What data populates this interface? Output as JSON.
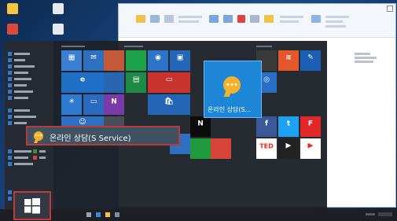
{
  "desktop": {
    "icons": [
      {
        "label": "",
        "color": "#f4c542"
      },
      {
        "label": "",
        "color": "#e6e9ef"
      },
      {
        "label": "",
        "color": "#d94a38"
      },
      {
        "label": "",
        "color": "#e6e9ef"
      }
    ]
  },
  "explorer": {
    "ribbon_tabs": [
      "",
      "",
      "",
      ""
    ]
  },
  "start_menu": {
    "search_row_label": "온라인 상담(S Service)",
    "popup_tile_label": "온라인 상담(S...",
    "tiles": [
      {
        "name": "tile-calendar",
        "label": "",
        "color": "#3b7fd0",
        "glyph": "▦"
      },
      {
        "name": "tile-mail",
        "label": "",
        "color": "#2f6fc0",
        "glyph": "✉"
      },
      {
        "name": "tile-news-photo",
        "label": "",
        "color": "#c25a3a",
        "glyph": ""
      },
      {
        "name": "tile-green-text",
        "label": "",
        "color": "#1fa34a",
        "glyph": ""
      },
      {
        "name": "tile-groove",
        "label": "",
        "color": "#2d73c8",
        "glyph": "◉"
      },
      {
        "name": "tile-movies",
        "label": "",
        "color": "#2566b8",
        "glyph": "▣"
      },
      {
        "name": "tile-edge",
        "label": "",
        "color": "#1f6fc7",
        "glyph": "e"
      },
      {
        "name": "tile-photos",
        "label": "",
        "color": "#2a65b0",
        "glyph": ""
      },
      {
        "name": "tile-excel-app",
        "label": "",
        "color": "#1f8a46",
        "glyph": "▤"
      },
      {
        "name": "tile-video-red",
        "label": "",
        "color": "#c9332d",
        "glyph": "▭"
      },
      {
        "name": "tile-weather",
        "label": "",
        "color": "#2e7ad1",
        "glyph": "☀"
      },
      {
        "name": "tile-pc",
        "label": "",
        "color": "#2a6bc0",
        "glyph": "▭"
      },
      {
        "name": "tile-onenote",
        "label": "",
        "color": "#7a3aa8",
        "glyph": "N"
      },
      {
        "name": "tile-store",
        "label": "",
        "color": "#2565b5",
        "glyph": "🛍"
      },
      {
        "name": "tile-people",
        "label": "",
        "color": "#2d6fc0",
        "glyph": "☺"
      },
      {
        "name": "tile-photo-strip",
        "label": "",
        "color": "#4a4f57",
        "glyph": ""
      },
      {
        "name": "tile-netflix",
        "label": "",
        "color": "#0b0b0b",
        "glyph": "N"
      },
      {
        "name": "tile-chat-small",
        "label": "",
        "color": "#2f6fc0",
        "glyph": ""
      },
      {
        "name": "tile-green-game",
        "label": "",
        "color": "#1f9a3c",
        "glyph": ""
      },
      {
        "name": "tile-red-social",
        "label": "",
        "color": "#d6443a",
        "glyph": ""
      },
      {
        "name": "tile-facebook",
        "label": "",
        "color": "#3b5998",
        "glyph": "f"
      },
      {
        "name": "tile-twitter",
        "label": "",
        "color": "#1da1f2",
        "glyph": "t"
      },
      {
        "name": "tile-flipboard",
        "label": "",
        "color": "#e12828",
        "glyph": "F"
      },
      {
        "name": "tile-ted",
        "label": "",
        "color": "#ffffff",
        "glyph": "TED"
      },
      {
        "name": "tile-music-dark",
        "label": "",
        "color": "#222222",
        "glyph": "▶"
      },
      {
        "name": "tile-app-red-yt",
        "label": "",
        "color": "#ffffff",
        "glyph": "▶"
      },
      {
        "name": "tile-app-colorful",
        "label": "",
        "color": "#3a3a3a",
        "glyph": ""
      },
      {
        "name": "tile-app-stack",
        "label": "",
        "color": "#e3572a",
        "glyph": "≋"
      },
      {
        "name": "tile-app-blue",
        "label": "",
        "color": "#1d5fb5",
        "glyph": "✎"
      },
      {
        "name": "tile-app-bluegreen",
        "label": "",
        "color": "#2a6fc6",
        "glyph": "◎"
      }
    ]
  },
  "colors": {
    "highlight_border": "#c23a3a",
    "accent": "#1d86d6",
    "chat_icon": "#f5b32a"
  }
}
